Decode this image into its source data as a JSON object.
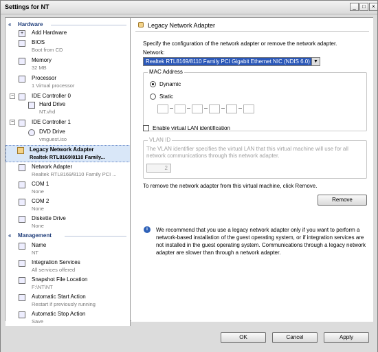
{
  "window": {
    "title": "Settings for NT",
    "controls": [
      "_",
      "□",
      "×"
    ]
  },
  "sidebar": {
    "sections": [
      {
        "title": "Hardware"
      },
      {
        "title": "Management"
      }
    ],
    "hardware": [
      {
        "label": "Add Hardware",
        "sub": ""
      },
      {
        "label": "BIOS",
        "sub": "Boot from CD"
      },
      {
        "label": "Memory",
        "sub": "32 MB"
      },
      {
        "label": "Processor",
        "sub": "1 Virtual processor"
      },
      {
        "label": "IDE Controller 0",
        "sub": ""
      },
      {
        "label": "Hard Drive",
        "sub": "NT.vhd"
      },
      {
        "label": "IDE Controller 1",
        "sub": ""
      },
      {
        "label": "DVD Drive",
        "sub": "vmguest.iso"
      },
      {
        "label": "Legacy Network Adapter",
        "sub": "Realtek RTL8169/8110 Family..."
      },
      {
        "label": "Network Adapter",
        "sub": "Realtek RTL8169/8110 Family PCI ..."
      },
      {
        "label": "COM 1",
        "sub": "None"
      },
      {
        "label": "COM 2",
        "sub": "None"
      },
      {
        "label": "Diskette Drive",
        "sub": "None"
      }
    ],
    "management": [
      {
        "label": "Name",
        "sub": "NT"
      },
      {
        "label": "Integration Services",
        "sub": "All services offered"
      },
      {
        "label": "Snapshot File Location",
        "sub": "F:\\NT\\NT"
      },
      {
        "label": "Automatic Start Action",
        "sub": "Restart if previously running"
      },
      {
        "label": "Automatic Stop Action",
        "sub": "Save"
      }
    ]
  },
  "panel": {
    "header": "Legacy Network Adapter",
    "description": "Specify the configuration of the network adapter or remove the network adapter.",
    "network_label": "Network:",
    "network_value": "Realtek RTL8169/8110 Family PCI Gigabit Ethernet NIC (NDIS 6.0)",
    "mac": {
      "group_label": "MAC Address",
      "dynamic": "Dynamic",
      "static": "Static",
      "selected": "Dynamic",
      "octets": [
        "",
        "",
        "",
        "",
        "",
        ""
      ]
    },
    "vlan": {
      "checkbox_label": "Enable virtual LAN identification",
      "checked": false,
      "group_label": "VLAN ID",
      "text": "The VLAN identifier specifies the virtual LAN that this virtual machine will use for all network communications through this network adapter.",
      "value": "2"
    },
    "remove_text": "To remove the network adapter from this virtual machine, click Remove.",
    "remove_button": "Remove",
    "info_text": "We recommend that you use a legacy network adapter only if you want to perform a network-based installation of the guest operating system, or if integration services are not installed in the guest operating system. Communications through a legacy network adapter are slower than through a network adapter."
  },
  "footer": {
    "ok": "OK",
    "cancel": "Cancel",
    "apply": "Apply"
  },
  "colors": {
    "selection": "#d9e7f8",
    "dropdown_highlight": "#2a57b8",
    "info_icon": "#2e61b8"
  }
}
